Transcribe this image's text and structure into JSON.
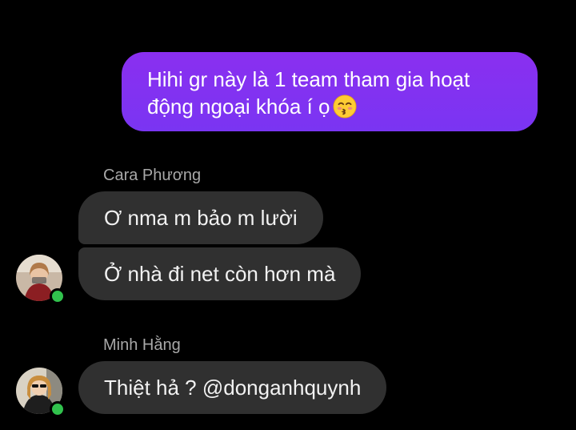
{
  "sent_message": {
    "line1": "Hihi gr này là 1 team tham gia hoạt",
    "line2": "động ngoại khóa í ọ",
    "emoji": "kissing-face-with-closed-eyes"
  },
  "groups": [
    {
      "sender": "Cara Phương",
      "messages": [
        "Ơ nma m bảo m lười",
        "Ở nhà đi net còn hơn mà"
      ],
      "online": true
    },
    {
      "sender": "Minh Hằng",
      "messages": [
        "Thiệt hả ? @donganhquynh"
      ],
      "online": true
    }
  ],
  "colors": {
    "background": "#000000",
    "sent_bubble": "#7a35f2",
    "received_bubble": "#303030",
    "online_dot": "#31c24d",
    "sender_name": "#a8a8a8"
  }
}
